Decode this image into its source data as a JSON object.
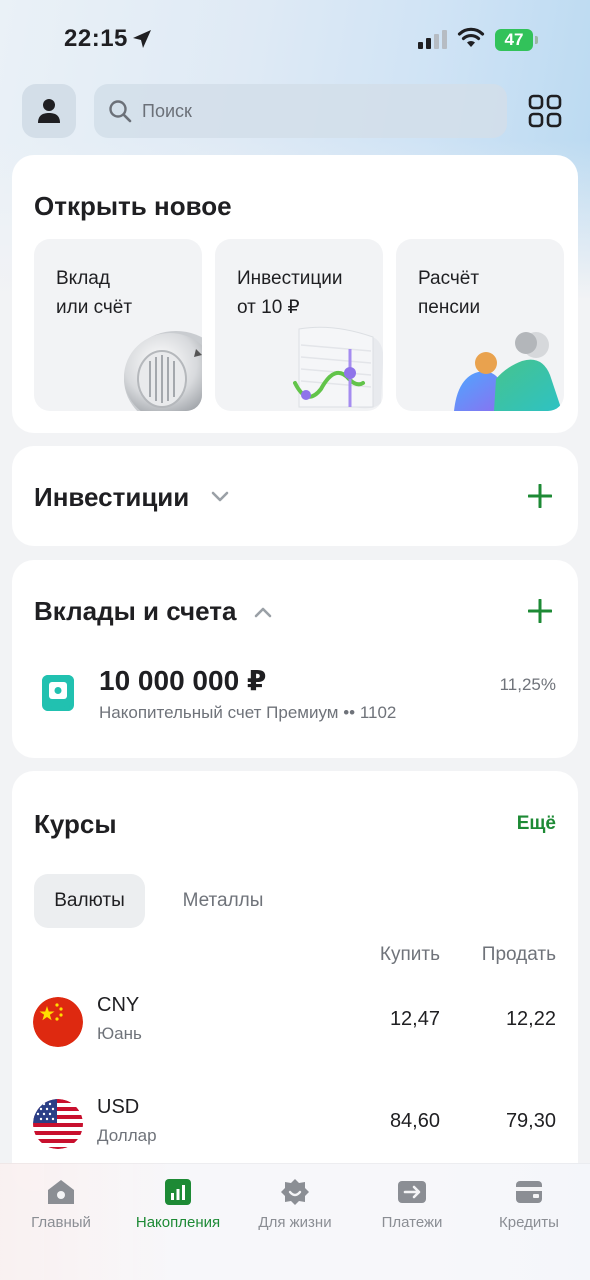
{
  "status_bar": {
    "time": "22:15",
    "battery": "47"
  },
  "header": {
    "search_placeholder": "Поиск"
  },
  "open_new": {
    "title": "Открыть новое",
    "tiles": [
      {
        "label": "Вклад\nили счёт"
      },
      {
        "label": "Инвестиции\nот 10 ₽"
      },
      {
        "label": "Расчёт\nпенсии"
      }
    ]
  },
  "investments": {
    "title": "Инвестиции"
  },
  "deposits": {
    "title": "Вклады и счета",
    "account": {
      "amount": "10 000 000 ₽",
      "description": "Накопительный счет Премиум •• 1102",
      "rate": "11,25%"
    }
  },
  "rates": {
    "title": "Курсы",
    "more": "Ещё",
    "tabs": [
      "Валюты",
      "Металлы"
    ],
    "columns": {
      "buy": "Купить",
      "sell": "Продать"
    },
    "rows": [
      {
        "code": "CNY",
        "name": "Юань",
        "buy": "12,47",
        "sell": "12,22"
      },
      {
        "code": "USD",
        "name": "Доллар",
        "buy": "84,60",
        "sell": "79,30"
      }
    ]
  },
  "bottom_nav": {
    "items": [
      {
        "label": "Главный",
        "icon": "home-icon"
      },
      {
        "label": "Накопления",
        "icon": "savings-chart-icon"
      },
      {
        "label": "Для жизни",
        "icon": "lifestyle-icon"
      },
      {
        "label": "Платежи",
        "icon": "payments-icon"
      },
      {
        "label": "Кредиты",
        "icon": "credits-icon"
      }
    ],
    "active_index": 1
  },
  "colors": {
    "accent_green": "#1d8a35",
    "deposit_teal": "#21c1b0",
    "battery_green": "#32c25a"
  }
}
